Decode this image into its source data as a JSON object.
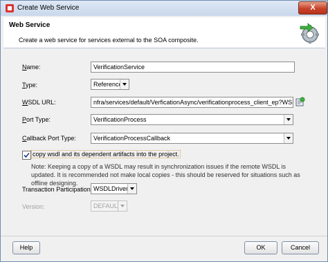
{
  "window": {
    "title": "Create Web Service",
    "close_label": "X"
  },
  "header": {
    "title": "Web Service",
    "description": "Create a web service for services external to the SOA composite.",
    "icon": "web-service-gear-icon"
  },
  "form": {
    "name": {
      "label_mnemonic": "N",
      "label_rest": "ame:",
      "value": "VerificationService"
    },
    "type": {
      "label_mnemonic": "T",
      "label_rest": "ype:",
      "value": "Reference"
    },
    "wsdl_url": {
      "label_mnemonic": "W",
      "label_rest": "SDL URL:",
      "value": "nfra/services/default/VerficationAsync/verificationprocess_client_ep?WSDL"
    },
    "port_type": {
      "label_mnemonic": "P",
      "label_rest": "ort Type:",
      "value": "VerificationProcess"
    },
    "callback_port_type": {
      "label_mnemonic": "C",
      "label_rest": "allback Port Type:",
      "value": "VerificationProcessCallback"
    },
    "copy_wsdl": {
      "checked": true,
      "label": "copy wsdl and its dependent artifacts into the project."
    },
    "note": "Note: Keeping a copy of a WSDL may result in synchronization issues if the remote WSDL is updated. It is recommended not make local copies - this should be reserved for situations such as offline designing.",
    "transaction": {
      "label": "Transaction Participation:",
      "value": "WSDLDriven"
    },
    "version": {
      "label": "Version:",
      "value": "DEFAULT"
    }
  },
  "buttons": {
    "help": "Help",
    "ok": "OK",
    "cancel": "Cancel"
  }
}
